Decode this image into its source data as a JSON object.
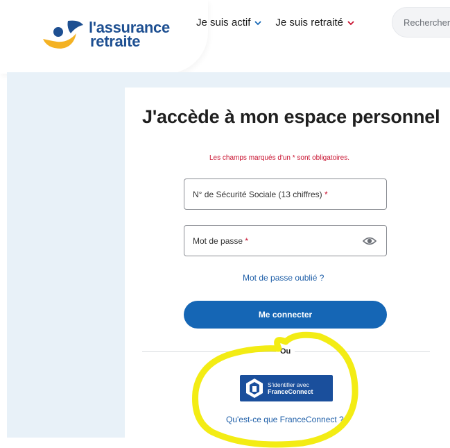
{
  "header": {
    "logo_line1": "l'assurance",
    "logo_line2": "retraite",
    "nav": [
      {
        "label": "Je suis actif"
      },
      {
        "label": "Je suis retraité"
      }
    ],
    "search_placeholder": "Rechercher"
  },
  "login": {
    "title": "J'accède à mon espace personnel",
    "required_note": "Les champs marqués d'un * sont obligatoires.",
    "ssn_label": "N° de Sécurité Sociale (13 chiffres)",
    "password_label": "Mot de passe",
    "asterisk": "*",
    "forgot_link": "Mot de passe oublié ?",
    "connect_button": "Me connecter",
    "or_label": "Ou"
  },
  "franceconnect": {
    "button_line1": "S'identifier avec",
    "button_line2": "FranceConnect",
    "info_link": "Qu'est-ce que FranceConnect ?"
  },
  "colors": {
    "brand_blue": "#1d4f91",
    "primary_button": "#1566b5",
    "required_red": "#c8102e",
    "link_blue": "#1f5fa8",
    "panel_bg": "#e8f1f8",
    "highlight_yellow": "#f2ea00"
  }
}
